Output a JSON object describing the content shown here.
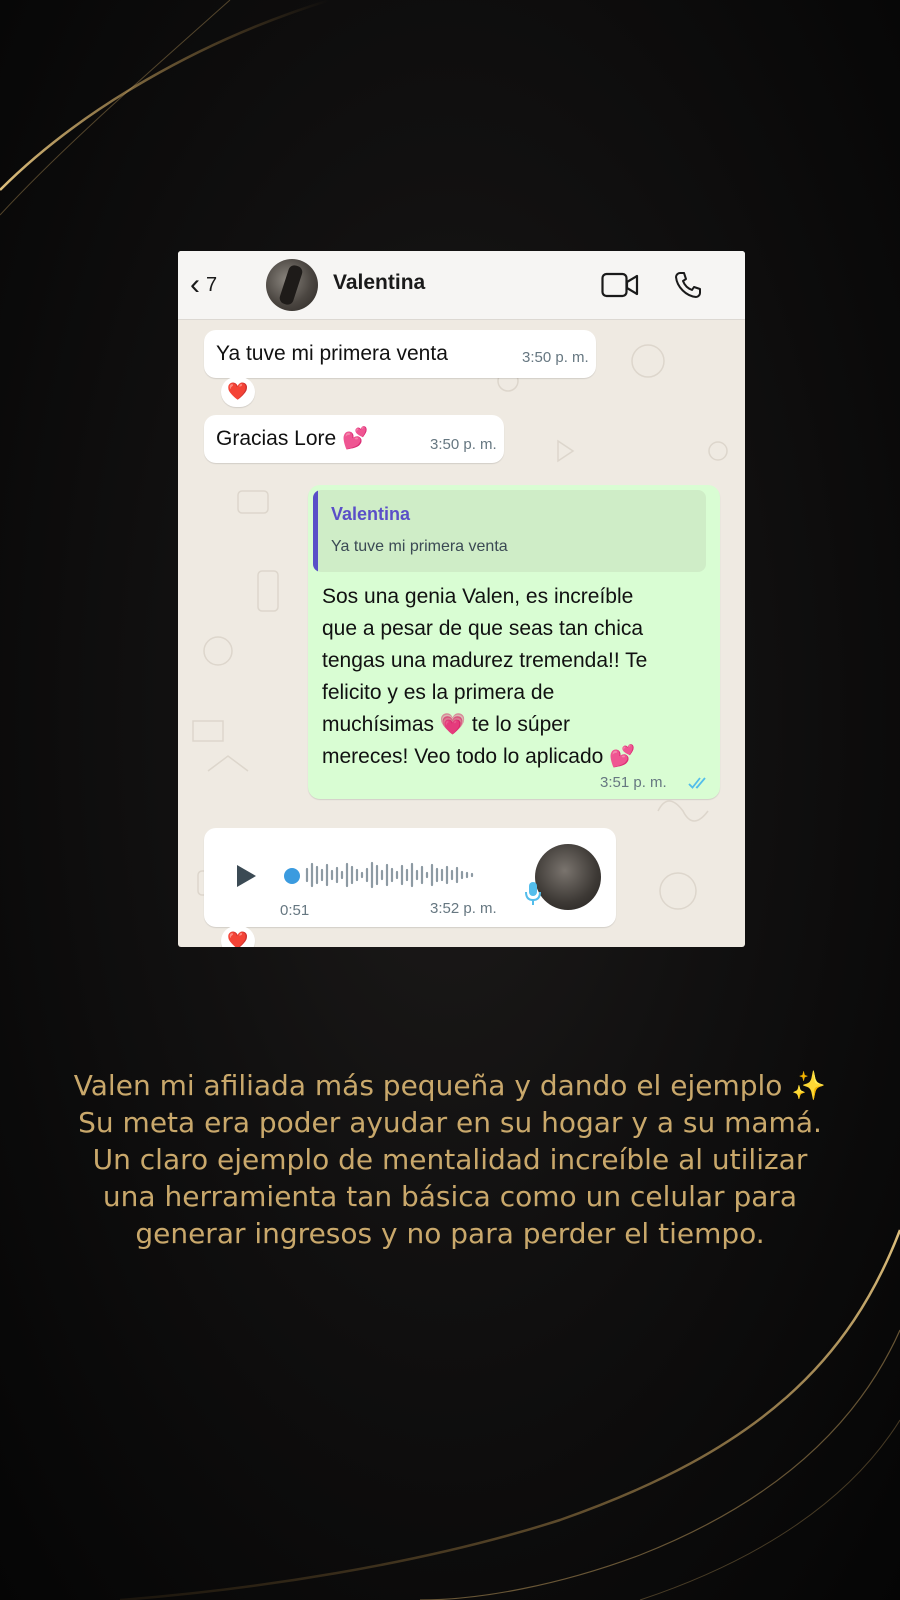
{
  "chat": {
    "header": {
      "back_count": "7",
      "contact_name": "Valentina",
      "icons": [
        "chevron-left-icon",
        "video-call-icon",
        "phone-call-icon"
      ]
    },
    "messages": [
      {
        "type": "incoming",
        "text": "Ya tuve mi primera venta",
        "time": "3:50 p. m.",
        "reaction": "❤️"
      },
      {
        "type": "incoming",
        "text": "Gracias Lore",
        "emoji": "💕",
        "time": "3:50 p. m."
      },
      {
        "type": "outgoing",
        "quote": {
          "author": "Valentina",
          "text": "Ya tuve mi primera venta"
        },
        "lines": [
          "Sos una genia Valen, es increíble",
          "que a pesar de que seas tan chica",
          "tengas una madurez tremenda!! Te",
          "felicito y es la primera de",
          "muchísimas",
          "te lo súper",
          "mereces! Veo todo lo aplicado"
        ],
        "emoji_heart": "💗",
        "emoji_end": "💕",
        "time": "3:51 p. m.",
        "status": "read-double-check"
      },
      {
        "type": "incoming-voice",
        "duration": "0:51",
        "time": "3:52 p. m.",
        "reaction": "❤️"
      }
    ]
  },
  "caption": {
    "lines": [
      "Valen mi afiliada más pequeña y dando el ejemplo ✨",
      "Su meta era poder ayudar en su hogar y a su mamá.",
      "Un claro ejemplo de mentalidad increíble al utilizar",
      "una herramienta tan básica como un celular para",
      "generar ingresos y no para perder el tiempo."
    ]
  },
  "colors": {
    "caption_gold": "#c9a86b",
    "outgoing_bubble": "#d9fdd3",
    "quote_accent": "#5a4fc8",
    "read_check": "#53bdeb"
  }
}
